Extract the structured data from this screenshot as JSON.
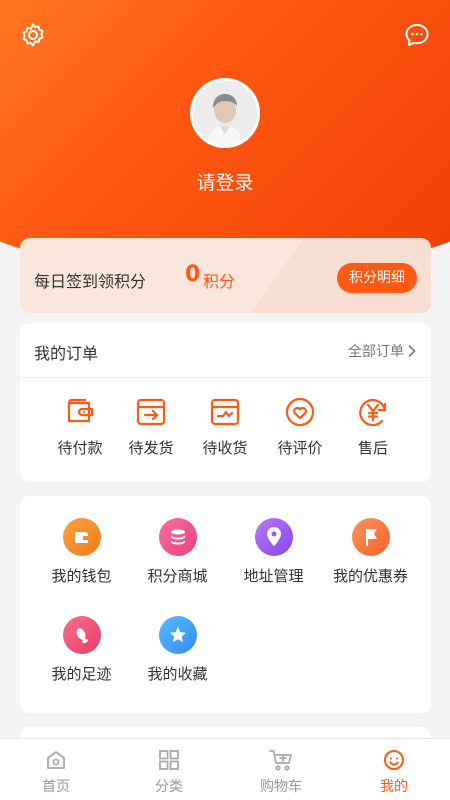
{
  "header": {
    "login_text": "请登录",
    "settings_icon": "gear-icon",
    "message_icon": "chat-bubble-icon",
    "gradient": [
      "#ff8a2b",
      "#ee3b00"
    ]
  },
  "points": {
    "label": "每日签到领积分",
    "value": "0",
    "unit": "积分",
    "detail_button": "积分明细"
  },
  "orders": {
    "title": "我的订单",
    "all_label": "全部订单",
    "items": [
      {
        "label": "待付款",
        "icon": "wallet-icon"
      },
      {
        "label": "待发货",
        "icon": "box-arrow-icon"
      },
      {
        "label": "待收货",
        "icon": "box-check-icon"
      },
      {
        "label": "待评价",
        "icon": "heart-circle-icon"
      },
      {
        "label": "售后",
        "icon": "yen-refresh-icon"
      }
    ]
  },
  "services": {
    "items": [
      {
        "label": "我的钱包",
        "icon": "wallet-icon",
        "color": "#f5882a"
      },
      {
        "label": "积分商城",
        "icon": "coins-icon",
        "color": "#f2568f"
      },
      {
        "label": "地址管理",
        "icon": "location-pin-icon",
        "color": "#9a5cf0"
      },
      {
        "label": "我的优惠券",
        "icon": "flag-icon",
        "color": "#f7793f"
      },
      {
        "label": "我的足迹",
        "icon": "footprint-icon",
        "color": "#f25577"
      },
      {
        "label": "我的收藏",
        "icon": "star-icon",
        "color": "#3ea4f5"
      }
    ]
  },
  "tabbar": {
    "active": "我的",
    "accent_color": "#ff5a14",
    "items": [
      {
        "label": "首页",
        "icon": "home-icon"
      },
      {
        "label": "分类",
        "icon": "grid-icon"
      },
      {
        "label": "购物车",
        "icon": "cart-icon"
      },
      {
        "label": "我的",
        "icon": "profile-face-icon"
      }
    ]
  }
}
